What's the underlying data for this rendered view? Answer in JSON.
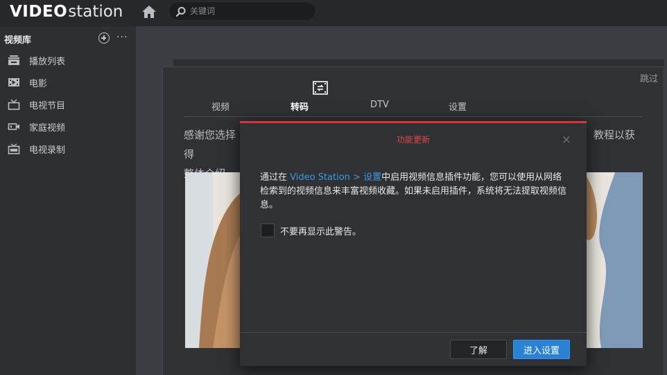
{
  "app": {
    "logo_part1": "VIDEO",
    "logo_part2": "station",
    "search_placeholder": "关键词"
  },
  "sidebar": {
    "header": "视频库",
    "more": "···",
    "items": [
      {
        "label": "播放列表",
        "icon": "playlist-icon"
      },
      {
        "label": "电影",
        "icon": "film-icon"
      },
      {
        "label": "电视节目",
        "icon": "tv-icon"
      },
      {
        "label": "家庭视频",
        "icon": "camcorder-icon"
      },
      {
        "label": "电视录制",
        "icon": "tv-record-icon"
      }
    ]
  },
  "panel": {
    "skip": "跳过",
    "tabs": [
      {
        "label": "视频",
        "active": false
      },
      {
        "label": "转码",
        "active": true
      },
      {
        "label": "DTV",
        "active": false
      },
      {
        "label": "设置",
        "active": false
      }
    ],
    "intro_line1_left": "感谢您选择",
    "intro_line1_right": "教程以获得",
    "intro_line2": "整体介绍，"
  },
  "dialog": {
    "title": "功能更新",
    "close": "×",
    "body_pre": "通过在 ",
    "body_link": "Video Station > 设置",
    "body_post": "中启用视频信息插件功能，您可以使用从网络检索到的视频信息来丰富视频收藏。如果未启用插件，系统将无法提取视频信息。",
    "checkbox_label": "不要再显示此警告。",
    "checkbox_checked": false,
    "btn_ok": "了解",
    "btn_settings": "进入设置"
  },
  "colors": {
    "accent_blue": "#2b82d4",
    "dialog_title_red": "#e04848",
    "link_blue": "#3b9ae6"
  }
}
